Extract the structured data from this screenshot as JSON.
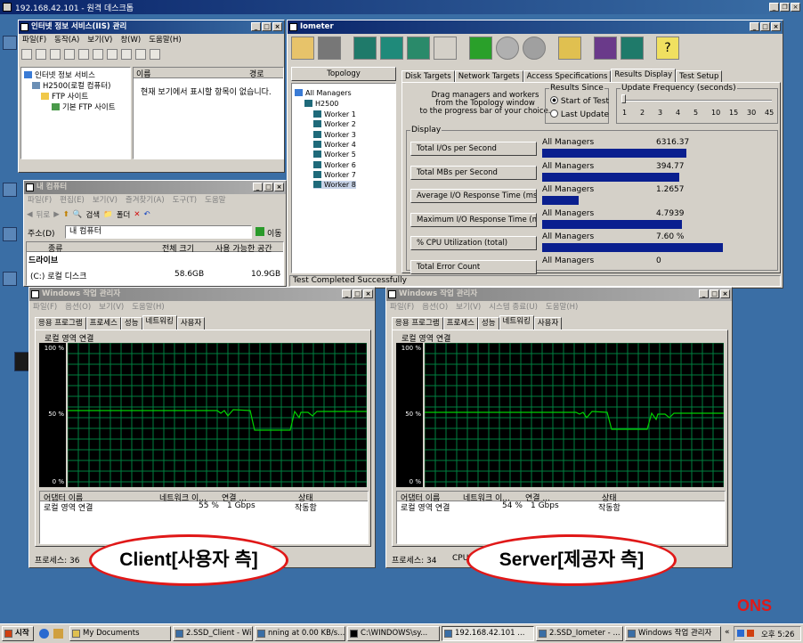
{
  "remote_title": "192.168.42.101 - 원격 데스크톱",
  "iis": {
    "title": "인터넷 정보 서비스(IIS) 관리",
    "menus": [
      "파일(F)",
      "동작(A)",
      "보기(V)",
      "창(W)",
      "도움말(H)"
    ],
    "tree": [
      "인터넷 정보 서비스",
      "H2500(로컬 컴퓨터)",
      "FTP 사이트",
      "기본 FTP 사이트"
    ],
    "col_name": "이름",
    "col_path": "경로",
    "empty_msg": "현재 보기에서 표시할 항목이 없습니다."
  },
  "mycomp": {
    "title": "내 컴퓨터",
    "menus": [
      "파일(F)",
      "편집(E)",
      "보기(V)",
      "즐겨찾기(A)",
      "도구(T)",
      "도움말"
    ],
    "back": "뒤로",
    "search": "검색",
    "folders": "폴더",
    "address_label": "주소(D)",
    "address_value": "내 컴퓨터",
    "go": "이동",
    "cols": [
      "종류",
      "전체 크기",
      "사용 가능한 공간"
    ],
    "section": "드라이브",
    "rows": [
      {
        "name": "(C:) 로컬 디스크",
        "total": "58.6GB",
        "free": "10.9GB"
      }
    ]
  },
  "iometer": {
    "title": "Iometer",
    "topology_header": "Topology",
    "topology_root": "All Managers",
    "topology_host": "H2500",
    "workers": [
      "Worker 1",
      "Worker 2",
      "Worker 3",
      "Worker 4",
      "Worker 5",
      "Worker 6",
      "Worker 7",
      "Worker 8"
    ],
    "tabs": [
      "Disk Targets",
      "Network Targets",
      "Access Specifications",
      "Results Display",
      "Test Setup"
    ],
    "drag_text": [
      "Drag managers and workers",
      "from the Topology window",
      "to the progress bar of your choice."
    ],
    "results_since_label": "Results Since",
    "radio_start": "Start of Test",
    "radio_last": "Last Update",
    "update_freq_label": "Update Frequency (seconds)",
    "freq_ticks": [
      "1",
      "2",
      "3",
      "4",
      "5",
      "10",
      "15",
      "30",
      "45"
    ],
    "display_label": "Display",
    "metrics": [
      {
        "label": "Total I/Os per Second",
        "manager": "All Managers",
        "value": "6316.37",
        "fill": 0.6
      },
      {
        "label": "Total MBs per Second",
        "manager": "All Managers",
        "value": "394.77",
        "fill": 0.57
      },
      {
        "label": "Average I/O Response Time (ms)",
        "manager": "All Managers",
        "value": "1.2657",
        "fill": 0.15
      },
      {
        "label": "Maximum I/O Response Time (ms)",
        "manager": "All Managers",
        "value": "4.7939",
        "fill": 0.58
      },
      {
        "label": "% CPU Utilization (total)",
        "manager": "All Managers",
        "value": "7.60 %",
        "fill": 0.75
      },
      {
        "label": "Total Error Count",
        "manager": "All Managers",
        "value": "0",
        "fill": 0
      }
    ],
    "status": "Test Completed Successfully"
  },
  "taskmgr_client": {
    "title": "Windows 작업 관리자",
    "menus": [
      "파일(F)",
      "옵션(O)",
      "보기(V)",
      "도움말(H)"
    ],
    "tabs": [
      "응용 프로그램",
      "프로세스",
      "성능",
      "네트워킹",
      "사용자"
    ],
    "section": "로컬 영역 연결",
    "y_labels": [
      "100 %",
      "50 %",
      "0 %"
    ],
    "cols": [
      "어댑터 이름",
      "네트워크 이...",
      "연결 ...",
      "상태"
    ],
    "row": {
      "name": "로컬 영역 연결",
      "util": "55 %",
      "speed": "1 Gbps",
      "state": "작동함"
    },
    "status": "프로세스: 36"
  },
  "taskmgr_server": {
    "title": "Windows 작업 관리자",
    "menus": [
      "파일(F)",
      "옵션(O)",
      "보기(V)",
      "시스템 종료(U)",
      "도움말(H)"
    ],
    "tabs": [
      "응용 프로그램",
      "프로세스",
      "성능",
      "네트워킹",
      "사용자"
    ],
    "section": "로컬 영역 연결",
    "y_labels": [
      "100 %",
      "50 %",
      "0 %"
    ],
    "cols": [
      "어댑터 이름",
      "네트워크 이...",
      "연결 ...",
      "상태"
    ],
    "row": {
      "name": "로컬 영역 연결",
      "util": "54 %",
      "speed": "1 Gbps",
      "state": "작동함"
    },
    "status": "프로세스: 34",
    "status2": "CPU"
  },
  "annotations": {
    "client": "Client[사용자 측]",
    "server": "Server[제공자 측]",
    "brand": "ONS"
  },
  "taskbar": {
    "start": "시작",
    "items": [
      "My Documents",
      "2.SSD_Client - Win...",
      "nning at 0.00 KB/s...",
      "C:\\WINDOWS\\sy...",
      "192.168.42.101 ...",
      "2.SSD_Iometer - ...",
      "Windows 작업 관리자"
    ],
    "clock": "오후 5:26"
  },
  "colors": {
    "desktop": "#3a6ea5",
    "title_active": "#0a246a",
    "graph_line": "#00d000",
    "graph_grid": "#008040",
    "annotation_red": "#e01818"
  }
}
